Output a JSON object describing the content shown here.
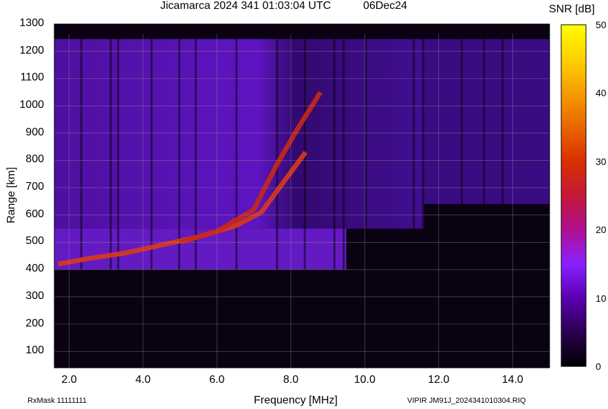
{
  "header": {
    "title": "Jicamarca 2024 341 01:03:04 UTC",
    "date": "06Dec24"
  },
  "footer": {
    "rxmask": "RxMask 11111111",
    "filename": "VIPIR  JM91J_2024341010304.RIQ"
  },
  "colorbar": {
    "label": "SNR [dB]",
    "ticks": [
      "50",
      "40",
      "30",
      "20",
      "10",
      "0"
    ],
    "range": [
      0,
      50
    ],
    "colors": [
      "#000000",
      "#2a0050",
      "#5a00b0",
      "#8a20ff",
      "#b01090",
      "#d02030",
      "#e05000",
      "#f09000",
      "#ffd000",
      "#ffff00"
    ]
  },
  "chart_data": {
    "type": "heatmap",
    "title": "Jicamarca 2024 341 01:03:04 UTC",
    "xlabel": "Frequency [MHz]",
    "ylabel": "Range [km]",
    "xlim": [
      1.6,
      15.0
    ],
    "ylim": [
      40,
      1300
    ],
    "xticks": [
      "2.0",
      "4.0",
      "6.0",
      "8.0",
      "10.0",
      "12.0",
      "14.0"
    ],
    "yticks": [
      "100",
      "200",
      "300",
      "400",
      "500",
      "600",
      "700",
      "800",
      "900",
      "1000",
      "1100",
      "1200",
      "1300"
    ],
    "zlabel": "SNR [dB]",
    "zlim": [
      0,
      50
    ],
    "grid": true,
    "traces": [
      {
        "name": "",
        "x": [
          1.7,
          2.5,
          3.5,
          4.5,
          5.5,
          6.5,
          7.2,
          7.8,
          8.4
        ],
        "y": [
          420,
          440,
          460,
          490,
          520,
          560,
          610,
          720,
          830
        ]
      },
      {
        "name": "",
        "x": [
          5.0,
          6.0,
          7.0,
          7.6,
          8.2,
          8.8
        ],
        "y": [
          500,
          540,
          620,
          780,
          920,
          1050
        ]
      }
    ]
  }
}
